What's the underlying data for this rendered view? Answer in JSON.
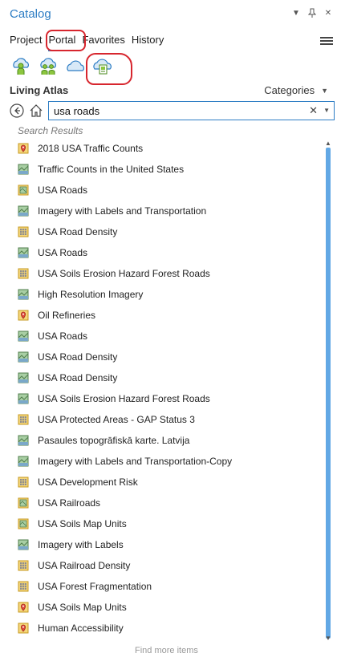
{
  "panel": {
    "title": "Catalog"
  },
  "tabs": [
    {
      "label": "Project"
    },
    {
      "label": "Portal"
    },
    {
      "label": "Favorites"
    },
    {
      "label": "History"
    }
  ],
  "portal_sources": [
    "my-content-icon",
    "my-groups-icon",
    "all-portal-icon",
    "living-atlas-icon"
  ],
  "living_atlas": {
    "label": "Living Atlas",
    "categories_label": "Categories"
  },
  "search": {
    "value": "usa roads"
  },
  "results_heading": "Search Results",
  "results": [
    {
      "label": "2018 USA Traffic Counts",
      "icon": "layer-package-icon"
    },
    {
      "label": "Traffic Counts in the United States",
      "icon": "web-map-icon"
    },
    {
      "label": "USA Roads",
      "icon": "map-image-layer-icon"
    },
    {
      "label": "Imagery with Labels and Transportation",
      "icon": "web-map-icon"
    },
    {
      "label": "USA Road Density",
      "icon": "tile-layer-icon"
    },
    {
      "label": "USA Roads",
      "icon": "web-map-icon"
    },
    {
      "label": "USA Soils Erosion Hazard Forest Roads",
      "icon": "tile-layer-icon"
    },
    {
      "label": "High Resolution Imagery",
      "icon": "web-map-icon"
    },
    {
      "label": "Oil Refineries",
      "icon": "layer-package-icon"
    },
    {
      "label": "USA Roads",
      "icon": "web-map-icon"
    },
    {
      "label": "USA Road Density",
      "icon": "web-map-icon"
    },
    {
      "label": "USA Road Density",
      "icon": "web-map-icon"
    },
    {
      "label": "USA Soils Erosion Hazard Forest Roads",
      "icon": "web-map-icon"
    },
    {
      "label": "USA Protected Areas - GAP Status 3",
      "icon": "tile-layer-icon"
    },
    {
      "label": "Pasaules topogrāfiskā karte. Latvija",
      "icon": "web-map-icon"
    },
    {
      "label": "Imagery with Labels and Transportation-Copy",
      "icon": "web-map-icon"
    },
    {
      "label": "USA Development Risk",
      "icon": "tile-layer-icon"
    },
    {
      "label": "USA Railroads",
      "icon": "map-image-layer-icon"
    },
    {
      "label": "USA Soils Map Units",
      "icon": "map-image-layer-icon"
    },
    {
      "label": "Imagery with Labels",
      "icon": "web-map-icon"
    },
    {
      "label": "USA Railroad Density",
      "icon": "tile-layer-icon"
    },
    {
      "label": "USA Forest Fragmentation",
      "icon": "tile-layer-icon"
    },
    {
      "label": "USA Soils Map Units",
      "icon": "layer-package-icon"
    },
    {
      "label": "Human Accessibility",
      "icon": "layer-package-icon"
    }
  ],
  "find_more": "Find more items",
  "colors": {
    "accent": "#2d7dc4",
    "annotation_red": "#d7262e",
    "scroll_thumb": "#62a8e5"
  }
}
